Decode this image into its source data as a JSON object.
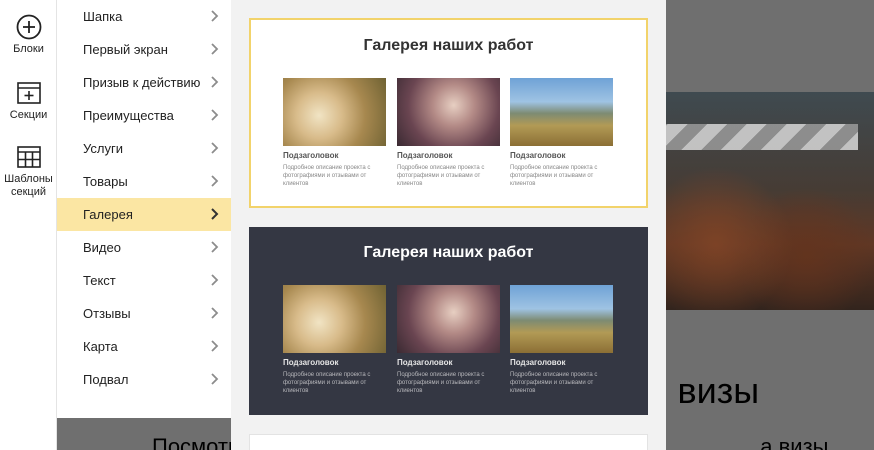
{
  "toolbar": {
    "items": [
      {
        "label": "Блоки",
        "icon": "plus-circle-icon"
      },
      {
        "label": "Секции",
        "icon": "section-add-icon"
      },
      {
        "label": "Шаблоны секций",
        "icon": "grid-template-icon"
      }
    ]
  },
  "categories": [
    {
      "label": "Шапка"
    },
    {
      "label": "Первый экран"
    },
    {
      "label": "Призыв к действию"
    },
    {
      "label": "Преимущества"
    },
    {
      "label": "Услуги"
    },
    {
      "label": "Товары"
    },
    {
      "label": "Галерея",
      "active": true
    },
    {
      "label": "Видео"
    },
    {
      "label": "Текст"
    },
    {
      "label": "Отзывы"
    },
    {
      "label": "Карта"
    },
    {
      "label": "Подвал"
    }
  ],
  "templates": [
    {
      "theme": "light",
      "title": "Галерея наших работ",
      "items": [
        {
          "title": "Подзаголовок",
          "desc": "Подробное описание проекта с фотографиями и отзывами от клиентов"
        },
        {
          "title": "Подзаголовок",
          "desc": "Подробное описание проекта с фотографиями и отзывами от клиентов"
        },
        {
          "title": "Подзаголовок",
          "desc": "Подробное описание проекта с фотографиями и отзывами от клиентов"
        }
      ]
    },
    {
      "theme": "dark",
      "title": "Галерея наших работ",
      "items": [
        {
          "title": "Подзаголовок",
          "desc": "Подробное описание проекта с фотографиями и отзывами от клиентов"
        },
        {
          "title": "Подзаголовок",
          "desc": "Подробное описание проекта с фотографиями и отзывами от клиентов"
        },
        {
          "title": "Подзаголовок",
          "desc": "Подробное описание проекта с фотографиями и отзывами от клиентов"
        }
      ]
    }
  ],
  "background": {
    "heading": "я визы",
    "sub_left": "Посмотр",
    "sub_right": "а визы"
  },
  "colors": {
    "active_category": "#fbe6a3",
    "selected_border": "#f2d36b",
    "dark_card": "#343743"
  }
}
